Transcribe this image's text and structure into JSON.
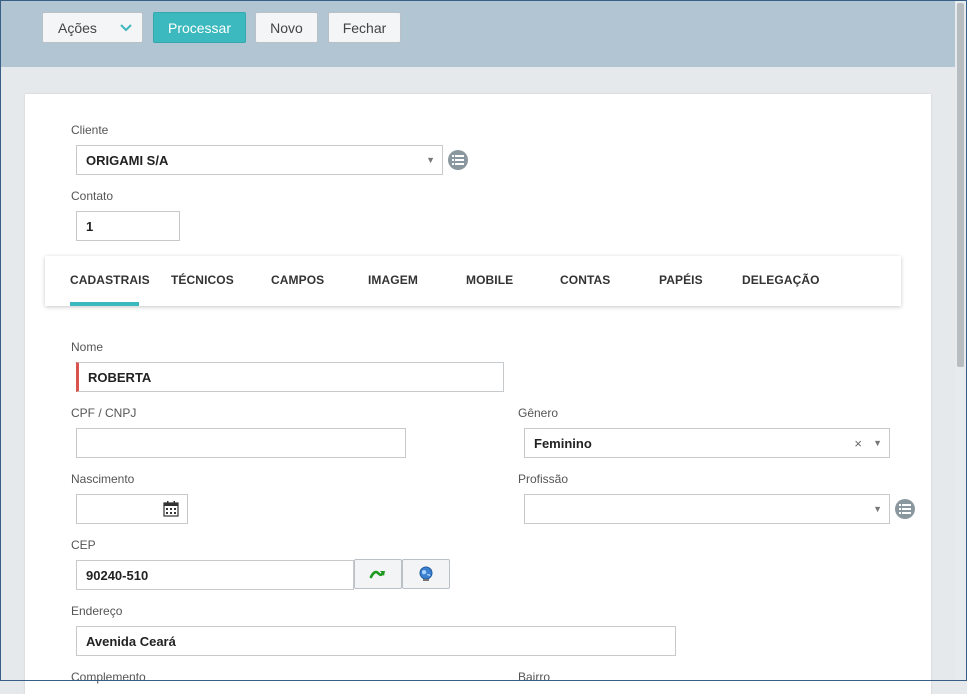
{
  "toolbar": {
    "actions_label": "Ações",
    "process_label": "Processar",
    "new_label": "Novo",
    "close_label": "Fechar"
  },
  "form": {
    "client_label": "Cliente",
    "client_value": "ORIGAMI S/A",
    "contact_label": "Contato",
    "contact_value": "1",
    "name_label": "Nome",
    "name_value": "ROBERTA",
    "cpf_label": "CPF / CNPJ",
    "cpf_value": "",
    "gender_label": "Gênero",
    "gender_value": "Feminino",
    "birth_label": "Nascimento",
    "birth_value": "",
    "profession_label": "Profissão",
    "profession_value": "",
    "cep_label": "CEP",
    "cep_value": "90240-510",
    "address_label": "Endereço",
    "address_value": "Avenida Ceará",
    "complement_label": "Complemento",
    "district_label": "Bairro"
  },
  "tabs": [
    {
      "label": "CADASTRAIS",
      "active": true
    },
    {
      "label": "TÉCNICOS"
    },
    {
      "label": "CAMPOS"
    },
    {
      "label": "IMAGEM"
    },
    {
      "label": "MOBILE"
    },
    {
      "label": "CONTAS"
    },
    {
      "label": "PAPÉIS"
    },
    {
      "label": "DELEGAÇÃO"
    }
  ],
  "colors": {
    "accent": "#3cb9be",
    "toolbar_bg": "#b1c5d2",
    "required_marker": "#d9534f"
  },
  "icons": {
    "list": "list-icon",
    "calendar": "calendar-icon",
    "cep_search": "green-arrow-icon",
    "globe": "globe-icon",
    "caret": "caret-down-icon",
    "clear": "clear-icon"
  }
}
